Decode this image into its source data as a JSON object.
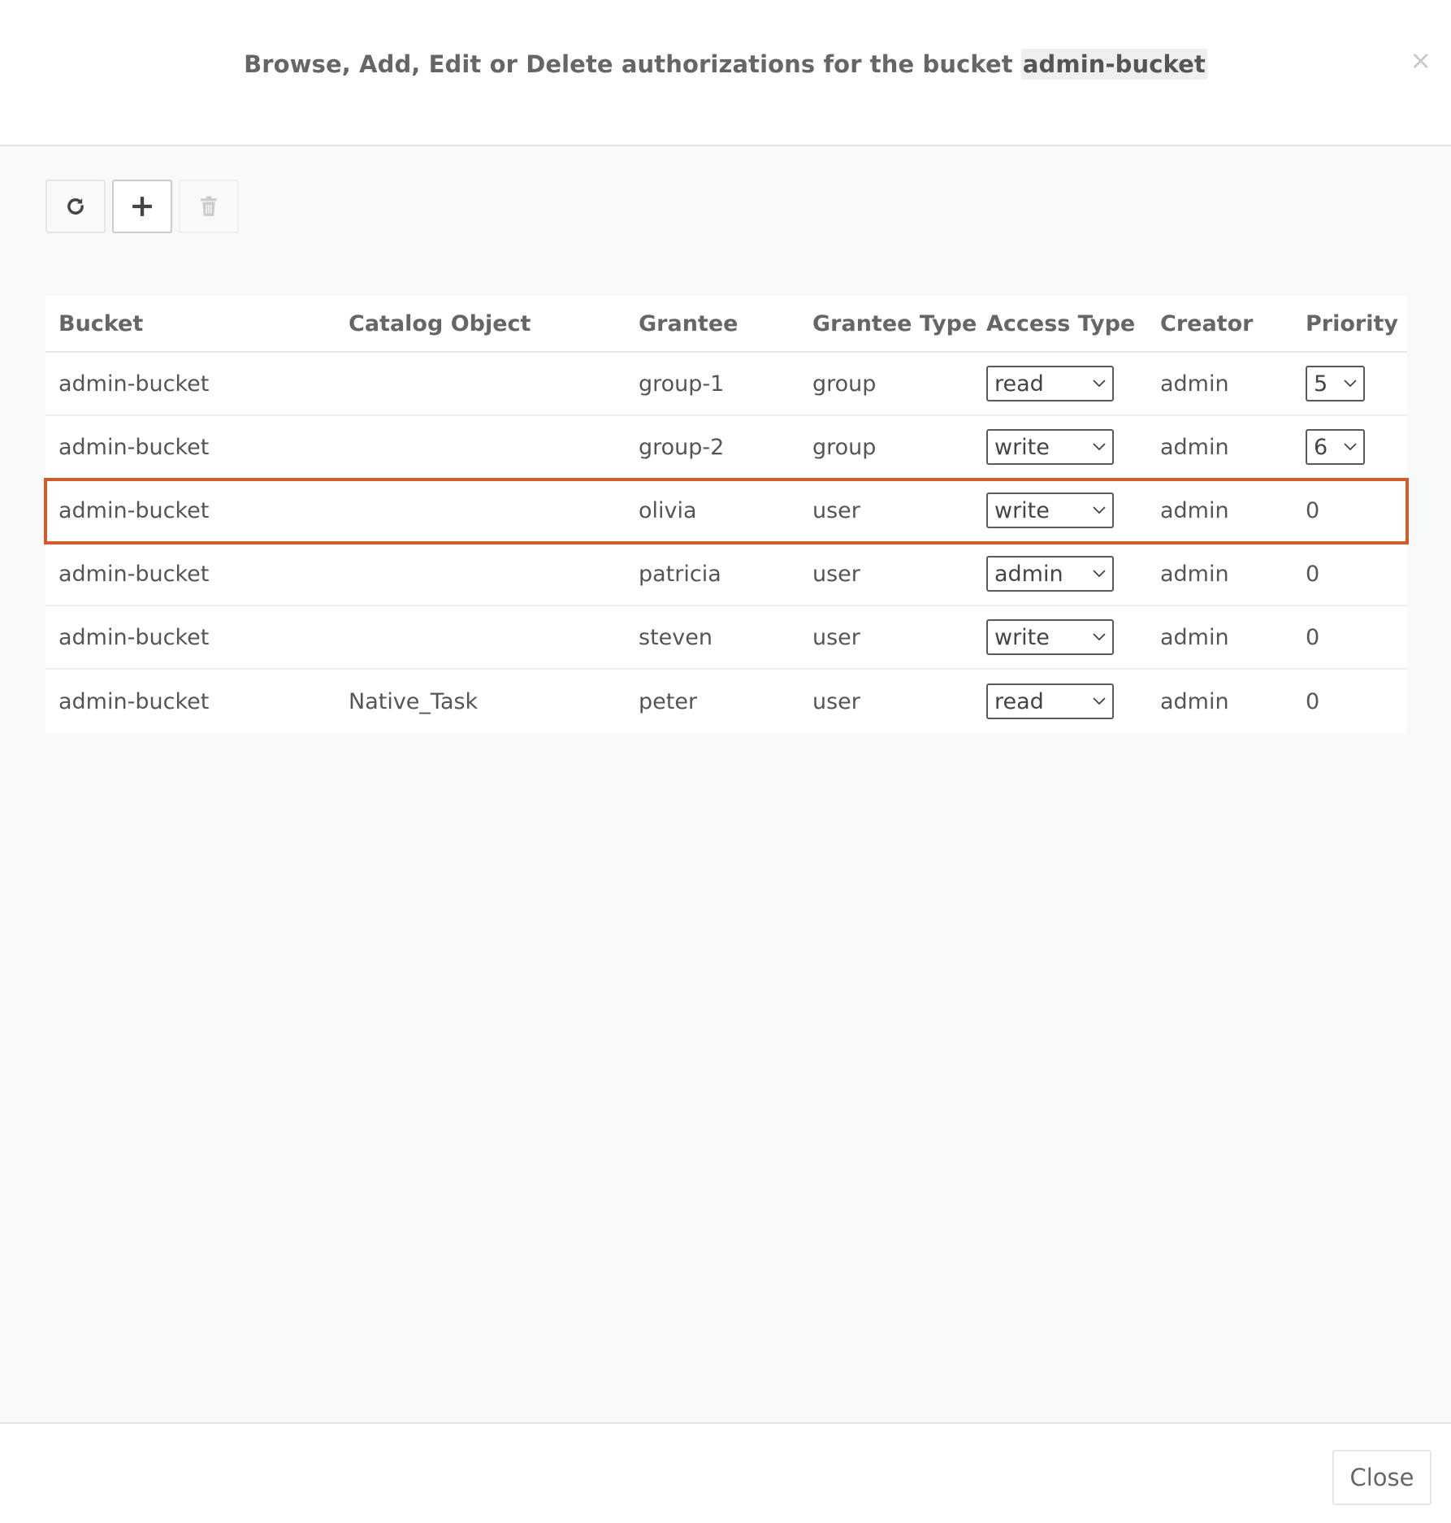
{
  "header": {
    "title_prefix": "Browse, Add, Edit or Delete authorizations for the bucket ",
    "bucket_name": "admin-bucket",
    "close_symbol": "×"
  },
  "toolbar": {
    "refresh_icon": "refresh-icon",
    "add_icon": "plus-icon",
    "delete_icon": "trash-icon"
  },
  "table": {
    "columns": [
      "Bucket",
      "Catalog Object",
      "Grantee",
      "Grantee Type",
      "Access Type",
      "Creator",
      "Priority"
    ],
    "rows": [
      {
        "bucket": "admin-bucket",
        "object": "",
        "grantee": "group-1",
        "grantee_type": "group",
        "access": "read",
        "creator": "admin",
        "priority": "5"
      },
      {
        "bucket": "admin-bucket",
        "object": "",
        "grantee": "group-2",
        "grantee_type": "group",
        "access": "write",
        "creator": "admin",
        "priority": "6"
      },
      {
        "bucket": "admin-bucket",
        "object": "",
        "grantee": "olivia",
        "grantee_type": "user",
        "access": "write",
        "creator": "admin",
        "priority": "0"
      },
      {
        "bucket": "admin-bucket",
        "object": "",
        "grantee": "patricia",
        "grantee_type": "user",
        "access": "admin",
        "creator": "admin",
        "priority": "0"
      },
      {
        "bucket": "admin-bucket",
        "object": "",
        "grantee": "steven",
        "grantee_type": "user",
        "access": "write",
        "creator": "admin",
        "priority": "0"
      },
      {
        "bucket": "admin-bucket",
        "object": "Native_Task",
        "grantee": "peter",
        "grantee_type": "user",
        "access": "read",
        "creator": "admin",
        "priority": "0"
      }
    ],
    "selected_row_color": "#d35a2a"
  },
  "footer": {
    "close_label": "Close"
  }
}
